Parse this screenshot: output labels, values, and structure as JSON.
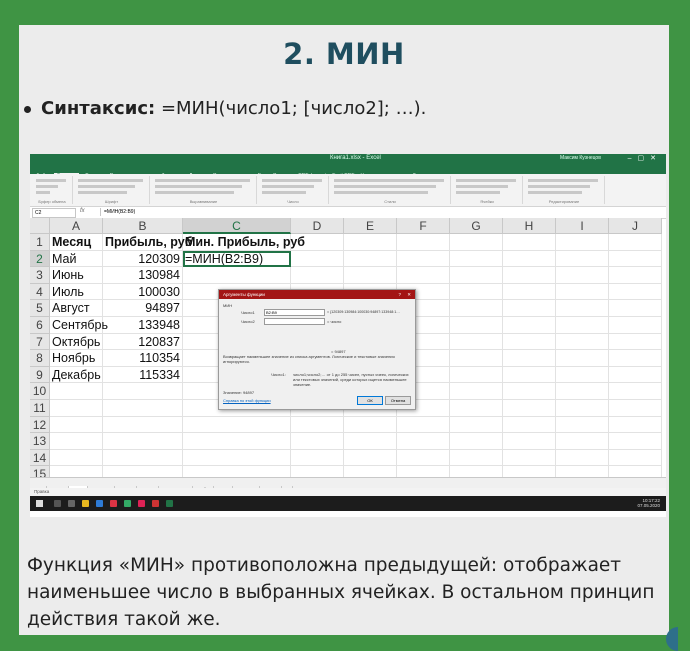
{
  "slide": {
    "title": "2. МИН",
    "syntax_label": "Синтаксис:",
    "syntax_text": " =МИН(число1; [число2]; …).",
    "description": "Функция «МИН» противоположна предыдущей: отображает наименьшее число в выбранных ячейках. В остальном принцип действия такой же."
  },
  "excel": {
    "window_title": "Книга1.xlsx - Excel",
    "user": "Максим Кузнецов",
    "menu": [
      "Файл",
      "Главная",
      "Вставка",
      "Разметка страницы",
      "Формулы",
      "Данные",
      "Рецензирование",
      "Вид",
      "Справка",
      "PDFelement",
      "Foxit PDF",
      "Что вы хотите сделать?"
    ],
    "active_menu": 1,
    "ribbon_groups": [
      "Буфер обмена",
      "Шрифт",
      "Выравнивание",
      "Число",
      "Стили",
      "Ячейки",
      "Редактирование"
    ],
    "name_box": "C2",
    "formula": "=МИН(B2:B9)",
    "columns": [
      "A",
      "B",
      "C",
      "D",
      "E",
      "F",
      "G",
      "H",
      "I",
      "J"
    ],
    "headers": [
      "Месяц",
      "Прибыль, руб",
      "Мин. Прибыль, руб"
    ],
    "rows": [
      {
        "month": "Май",
        "value": "120309",
        "formula": "=МИН(B2:B9)"
      },
      {
        "month": "Июнь",
        "value": "130984"
      },
      {
        "month": "Июль",
        "value": "100030"
      },
      {
        "month": "Август",
        "value": "94897"
      },
      {
        "month": "Сентябрь",
        "value": "133948"
      },
      {
        "month": "Октябрь",
        "value": "120837"
      },
      {
        "month": "Ноябрь",
        "value": "110354"
      },
      {
        "month": "Декабрь",
        "value": "115334"
      }
    ],
    "row_numbers": [
      "1",
      "2",
      "3",
      "4",
      "5",
      "6",
      "7",
      "8",
      "9",
      "10",
      "11",
      "12",
      "13",
      "14",
      "15"
    ],
    "sheet_tabs": [
      "МАКС",
      "МИН",
      "СРЗНАЧ",
      "СУММ",
      "ЕСЛИ",
      "СУММЕСЛИ",
      "СЧЁТ",
      "ДНИ",
      "КОРРЕЛ",
      "СЦЕП"
    ],
    "active_sheet": 1,
    "status": "Правка",
    "clock_time": "10:17:22",
    "clock_date": "07.05.2020",
    "dialog": {
      "title": "Аргументы функции",
      "func_name": "МИН",
      "arg1_label": "Число1",
      "arg1_value": "B2:B9",
      "arg1_result": "= {120309:130984:100030:94897:133948:1…",
      "arg2_label": "Число2",
      "arg2_result": "= число",
      "result_line": "= 94897",
      "description": "Возвращает наименьшее значение из списка аргументов. Логические и текстовые значения игнорируются.",
      "arg_desc_label": "Число1:",
      "arg_desc": "число1;число2;… от 1 до 255 чисел, пустых ячеек, логических или текстовых значений, среди которых ищется наименьшее значение.",
      "value_label": "Значение: 94897",
      "help_link": "Справка по этой функции",
      "ok": "ОК",
      "cancel": "Отмена"
    }
  }
}
